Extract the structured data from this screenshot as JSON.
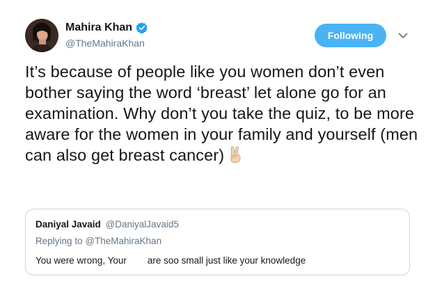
{
  "author": {
    "name": "Mahira Khan",
    "handle": "@TheMahiraKhan",
    "verified": true
  },
  "follow_button": {
    "label": "Following",
    "color": "#4ab3f4"
  },
  "menu": {
    "icon": "chevron-down-icon"
  },
  "tweet": {
    "text": "It’s because of people like you women don’t even bother saying the word ‘breast’ let alone go for an examination. Why don’t you take the quiz, to be more aware for the women in your family and yourself (men can also get breast cancer)",
    "emoji": "victory-hand-icon"
  },
  "quoted_tweet": {
    "name": "Daniyal Javaid",
    "handle": "@DaniyalJavaid5",
    "replying_prefix": "Replying to",
    "replying_to": "@TheMahiraKhan",
    "text": "You were wrong, Your        are soo small just like your knowledge"
  },
  "colors": {
    "accent": "#4ab3f4",
    "verified": "#1da1f2",
    "secondary_text": "#657786",
    "border": "#ccd6dd"
  }
}
